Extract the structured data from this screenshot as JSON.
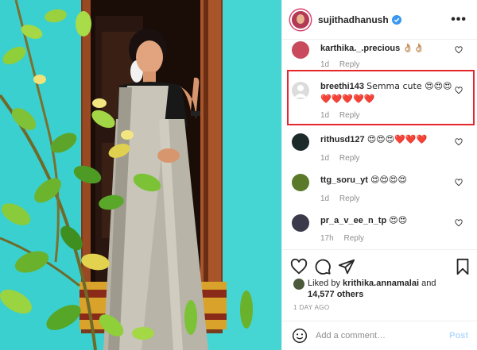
{
  "post": {
    "username": "sujithadhanush",
    "verified": true,
    "more_label": "•••"
  },
  "comments": [
    {
      "username": "karthika._.precious",
      "text": "👌🏼👌🏼",
      "time": "1d",
      "reply": "Reply",
      "avatar_color": "#c84a5c"
    },
    {
      "username": "breethi143",
      "text": "Semma cute 😍😍😍 ❤️❤️❤️❤️❤️",
      "time": "1d",
      "reply": "Reply",
      "avatar_color": "#dcdcdc",
      "highlighted": true
    },
    {
      "username": "rithusd127",
      "text": "😍😍😍❤️❤️❤️",
      "time": "1d",
      "reply": "Reply",
      "avatar_color": "#1d2a2a"
    },
    {
      "username": "ttg_soru_yt",
      "text": "😍😍😍😍",
      "time": "1d",
      "reply": "Reply",
      "avatar_color": "#5a7a2a"
    },
    {
      "username": "pr_a_v_ee_n_tp",
      "text": "😍😍",
      "time": "17h",
      "reply": "Reply",
      "avatar_color": "#3a3a4a"
    }
  ],
  "likes": {
    "prefix": "Liked by",
    "first_user": "krithika.annamalai",
    "joiner": "and",
    "others": "14,577 others"
  },
  "time_ago": "1 DAY AGO",
  "composer": {
    "placeholder": "Add a comment…",
    "post_label": "Post"
  },
  "icons": {
    "like": "heart-outline-icon",
    "comment": "comment-bubble-icon",
    "share": "paper-plane-icon",
    "save": "bookmark-icon",
    "emoji": "smiley-icon",
    "verified": "verified-badge-icon"
  },
  "colors": {
    "wall": "#3ad0cf",
    "highlight_box": "#e5262d",
    "verified": "#3897f0",
    "heart": "#ed4956",
    "post_disabled": "#b3dbff"
  }
}
